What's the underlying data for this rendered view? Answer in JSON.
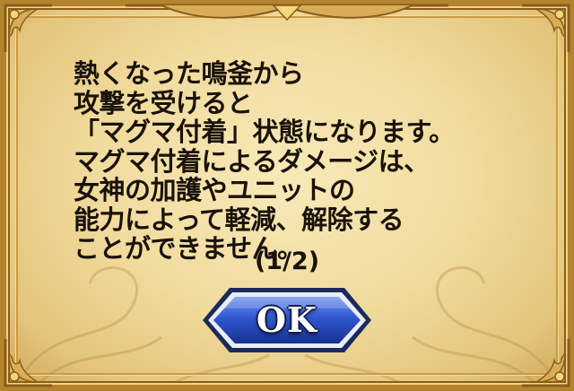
{
  "dialog": {
    "lines": [
      "熱くなった鳴釜から",
      "攻撃を受けると",
      "「マグマ付着」状態になります。",
      "マグマ付着によるダメージは、",
      "女神の加護やユニットの",
      "能力によって軽減、解除する",
      "ことができません。"
    ],
    "page_indicator": "(1/2)",
    "ok_label": "OK"
  },
  "colors": {
    "parchment": "#f1dc9f",
    "frame_gold": "#b4832e",
    "text": "#1a1208",
    "button_blue": "#2a52c9",
    "button_border": "#e8edf8"
  }
}
